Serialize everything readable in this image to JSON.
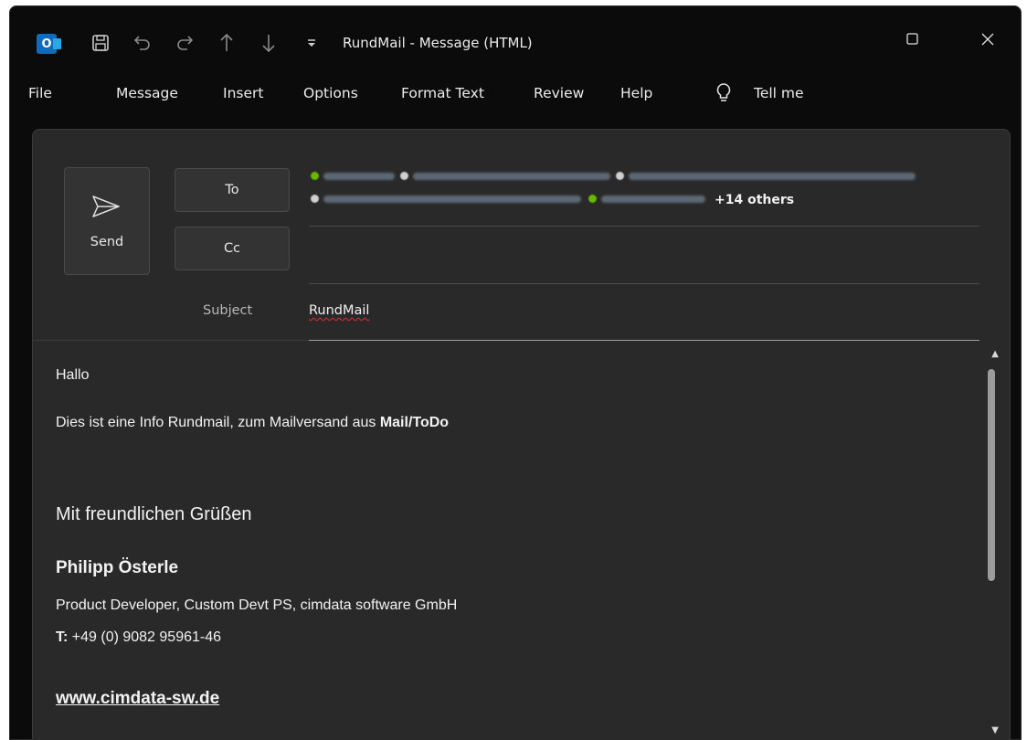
{
  "titlebar": {
    "app_icon_letter": "O",
    "title": "RundMail  -  Message (HTML)",
    "icons": [
      "save-icon",
      "undo-icon",
      "redo-icon",
      "up-arrow-icon",
      "down-arrow-icon",
      "quick-access-dropdown-icon"
    ],
    "window_controls": [
      "maximize-icon",
      "close-icon"
    ]
  },
  "menu": {
    "items": [
      "File",
      "Message",
      "Insert",
      "Options",
      "Format Text",
      "Review",
      "Help"
    ],
    "tell_me": "Tell me"
  },
  "compose": {
    "send_label": "Send",
    "to_label": "To",
    "cc_label": "Cc",
    "recipients_more": "+14 others",
    "subject_label": "Subject",
    "subject_value": "RundMail"
  },
  "body": {
    "greeting": "Hallo",
    "intro": "Dies ist eine Info Rundmail, zum Mailversand aus ",
    "intro_bold": "Mail/ToDo",
    "closing": "Mit freundlichen Grüßen",
    "sig_name": "Philipp Österle",
    "sig_role": "Product Developer, Custom Devt PS, cimdata software GmbH",
    "sig_phone_label": "T:",
    "sig_phone": " +49 (0) 9082 95961-46",
    "sig_web": "www.cimdata-sw.de"
  },
  "colors": {
    "window_bg": "#0b0b0b",
    "compose_bg": "#292929",
    "outlook_blue": "#0f6cbd",
    "presence_green": "#6bb700"
  }
}
